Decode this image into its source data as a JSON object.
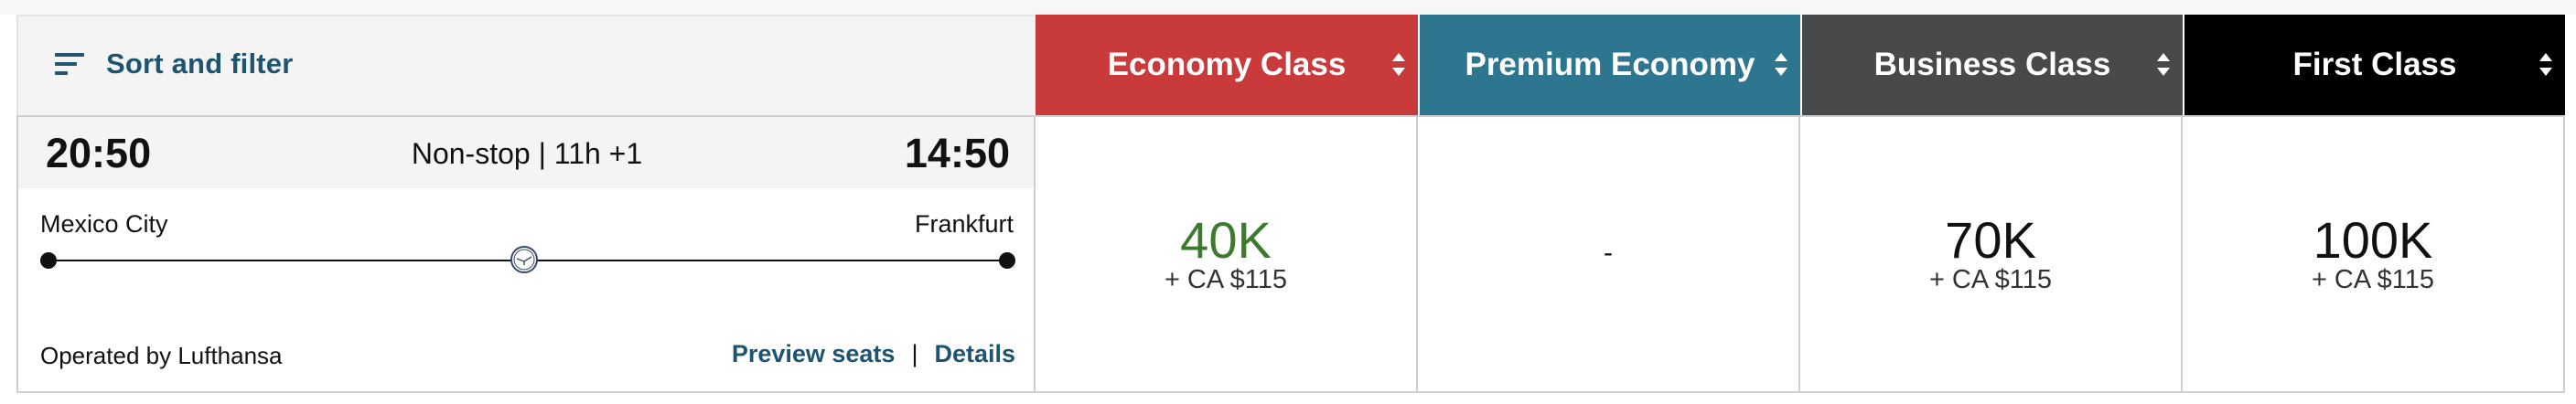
{
  "sort": {
    "label": "Sort and filter",
    "icon": "filter-lines-icon"
  },
  "flight": {
    "departure_time": "20:50",
    "arrival_time": "14:50",
    "duration": "Non-stop | 11h +1",
    "origin": "Mexico City",
    "destination": "Frankfurt",
    "operated_by": "Operated by Lufthansa",
    "airline_icon": "lufthansa-logo-icon",
    "links": {
      "preview_seats": "Preview seats",
      "separator": "|",
      "details": "Details"
    }
  },
  "cabins": [
    {
      "name": "Economy Class",
      "header_color": "#c93b3b",
      "points": "40K",
      "points_color": "#3c7a2e",
      "cash": "+ CA $115",
      "available": true
    },
    {
      "name": "Premium Economy",
      "header_color": "#2e7590",
      "points": "",
      "cash": "",
      "unavailable_text": "-",
      "available": false
    },
    {
      "name": "Business Class",
      "header_color": "#48494b",
      "points": "70K",
      "points_color": "#111111",
      "cash": "+ CA $115",
      "available": true
    },
    {
      "name": "First Class",
      "header_color": "#000000",
      "points": "100K",
      "points_color": "#111111",
      "cash": "+ CA $115",
      "available": true
    }
  ]
}
